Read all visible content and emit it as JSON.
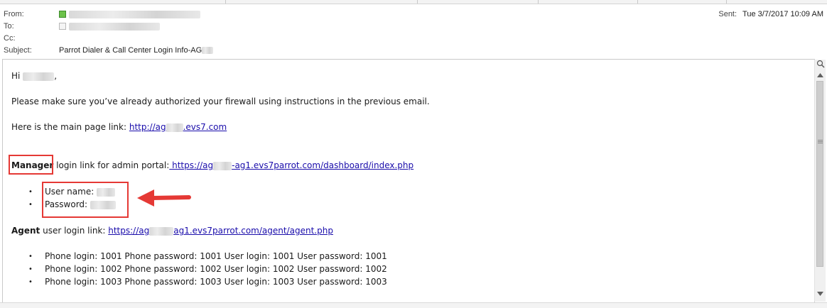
{
  "header": {
    "from_label": "From:",
    "to_label": "To:",
    "cc_label": "Cc:",
    "subject_label": "Subject:",
    "subject": "Parrot Dialer & Call Center Login Info-AG",
    "sent_label": "Sent:",
    "sent_value": "Tue 3/7/2017 10:09 AM"
  },
  "body": {
    "greeting": "Hi",
    "greeting_end": ",",
    "line1": "Please make sure you’ve already authorized your firewall using instructions in the previous email.",
    "main_link_prefix": "Here is the main page link: ",
    "main_link_a": "http://ag",
    "main_link_b": ".evs7.com",
    "manager_bold": "Manager",
    "manager_text": " login link for admin portal:",
    "manager_link_a": " https://ag",
    "manager_link_b": "-ag1.evs7parrot.com/dashboard/index.php",
    "username_label": "User name:",
    "password_label": "Password:",
    "agent_bold": "Agent",
    "agent_text": " user login link: ",
    "agent_link_a": "https://ag",
    "agent_link_b": "ag1.evs7parrot.com/agent/agent.php",
    "logins": [
      "Phone login: 1001  Phone password: 1001  User login: 1001  User password: 1001",
      "Phone login: 1002  Phone password: 1002  User login: 1002  User password: 1002",
      "Phone login: 1003  Phone password: 1003  User login: 1003  User password: 1003"
    ]
  },
  "colors": {
    "link": "#1a0dab",
    "highlight": "#e53935",
    "presence_online": "#6cc24a"
  },
  "icons": {
    "bullet": "•"
  }
}
